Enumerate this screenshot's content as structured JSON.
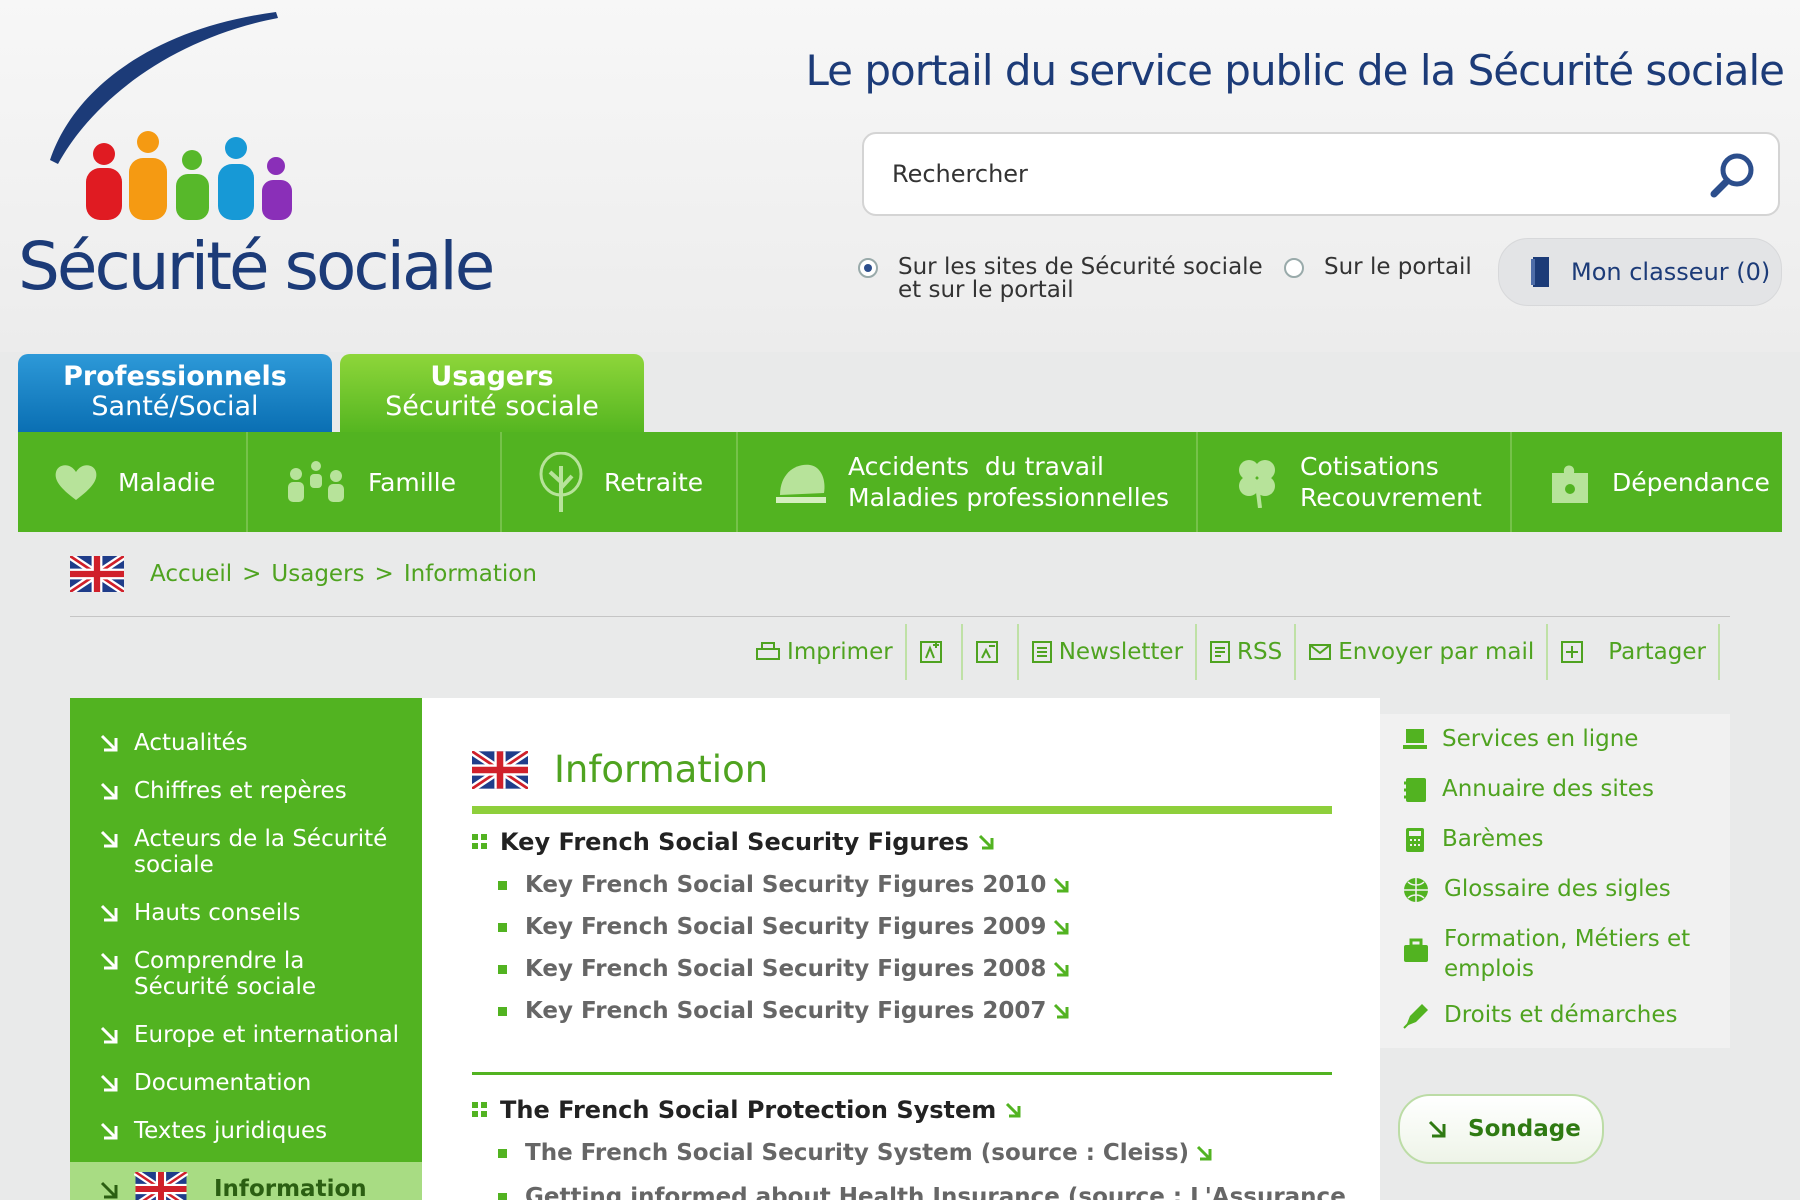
{
  "header": {
    "logo_text": "Sécurité sociale",
    "portal_title": "Le portail du service public de la Sécurité sociale",
    "search": {
      "placeholder": "Rechercher"
    },
    "scope": {
      "option_1_line1": "Sur les sites de Sécurité sociale",
      "option_1_line2": "et sur le portail",
      "option_2": "Sur le portail",
      "selected": "option_1"
    },
    "classeur_label": "Mon classeur (0)"
  },
  "audience_tabs": [
    {
      "line1": "Professionnels",
      "line2": "Santé/Social"
    },
    {
      "line1": "Usagers",
      "line2": "Sécurité sociale",
      "active": true
    }
  ],
  "nav": {
    "maladie": "Maladie",
    "famille": "Famille",
    "retraite": "Retraite",
    "accidents_1": "Accidents  du travail",
    "accidents_2": "Maladies professionnelles",
    "cotisations_1": "Cotisations",
    "cotisations_2": "Recouvrement",
    "dependance": "Dépendance"
  },
  "breadcrumb": {
    "home": "Accueil",
    "sep": ">",
    "usagers": "Usagers",
    "current": "Information"
  },
  "tools": {
    "print": "Imprimer",
    "newsletter": "Newsletter",
    "rss": "RSS",
    "mail": "Envoyer par mail",
    "share": "Partager"
  },
  "sidebar": {
    "items": [
      "Actualités",
      "Chiffres et repères",
      "Acteurs de la Sécurité sociale",
      "Hauts conseils",
      "Comprendre la Sécurité sociale",
      "Europe et international",
      "Documentation",
      "Textes juridiques"
    ],
    "active": "Information"
  },
  "content": {
    "title": "Information",
    "section1": {
      "title": "Key French Social Security Figures",
      "items": [
        "Key French Social Security Figures 2010",
        "Key French Social Security Figures 2009",
        "Key French Social Security Figures 2008",
        "Key French Social Security Figures 2007"
      ]
    },
    "section2": {
      "title": "The French Social Protection System",
      "items": [
        "The French Social Security System (source : Cleiss)",
        "Getting informed about Health Insurance (source : L'Assurance"
      ]
    }
  },
  "right": {
    "services": "Services en ligne",
    "annuaire": "Annuaire des sites",
    "baremes": "Barèmes",
    "glossaire": "Glossaire des sigles",
    "formation_1": "Formation, Métiers et",
    "formation_2": "emplois",
    "droits": "Droits et démarches",
    "sondage": "Sondage"
  },
  "colors": {
    "green": "#52b321",
    "blue_title": "#1c3b78",
    "pro_tab": "#0a6fb3",
    "light_green": "#8ecf3b"
  }
}
